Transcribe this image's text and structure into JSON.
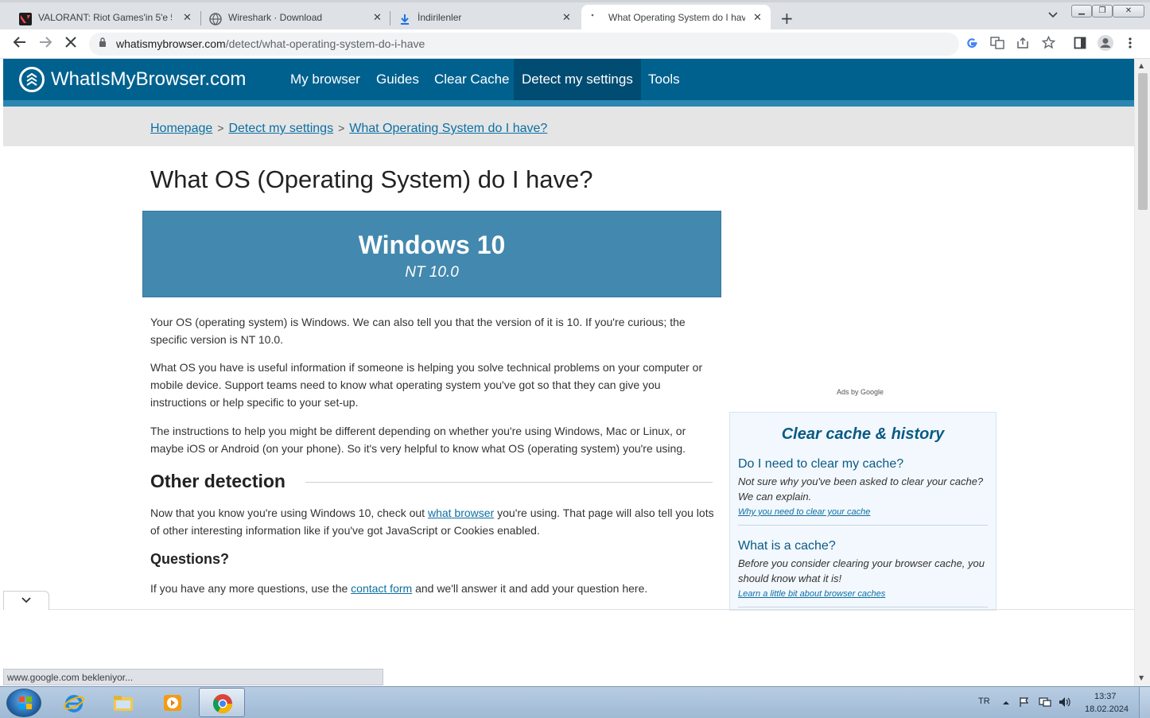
{
  "tabs": [
    {
      "title": "VALORANT: Riot Games'in 5'e 5",
      "icon": "valorant-icon",
      "color": "#d13639"
    },
    {
      "title": "Wireshark · Download",
      "icon": "globe-icon",
      "color": "#5f6368"
    },
    {
      "title": "İndirilenler",
      "icon": "download-icon",
      "color": "#1a73e8"
    },
    {
      "title": "What Operating System do I hav",
      "icon": "loading-icon",
      "color": "#5f6368"
    }
  ],
  "toolbar": {
    "url_host": "whatismybrowser.com",
    "url_path": "/detect/what-operating-system-do-i-have"
  },
  "site": {
    "logo": "WhatIsMyBrowser.com",
    "nav": [
      "My browser",
      "Guides",
      "Clear Cache",
      "Detect my settings",
      "Tools"
    ],
    "active_nav": "Detect my settings",
    "brand_color": "#00618f"
  },
  "breadcrumb": [
    "Homepage",
    "Detect my settings",
    "What Operating System do I have?"
  ],
  "content": {
    "title": "What OS (Operating System) do I have?",
    "os_name": "Windows 10",
    "os_version": "NT 10.0",
    "p1": "Your OS (operating system) is Windows. We can also tell you that the version of it is 10. If you're curious; the specific version is NT 10.0.",
    "p2": "What OS you have is useful information if someone is helping you solve technical problems on your computer or mobile device. Support teams need to know what operating system you've got so that they can give you instructions or help specific to your set-up.",
    "p3": "The instructions to help you might be different depending on whether you're using Windows, Mac or Linux, or maybe iOS or Android (on your phone). So it's very helpful to know what OS (operating system) you're using.",
    "other_heading": "Other detection",
    "p4_before": "Now that you know you're using Windows 10, check out ",
    "p4_link": "what browser",
    "p4_after": " you're using. That page will also tell you lots of other interesting information like if you've got JavaScript or Cookies enabled.",
    "questions_heading": "Questions?",
    "p5_before": "If you have any more questions, use the ",
    "p5_link": "contact form",
    "p5_after": " and we'll answer it and add your question here.",
    "ads_label": "Ads by Google"
  },
  "sidebar": {
    "title": "Clear cache & history",
    "items": [
      {
        "q": "Do I need to clear my cache?",
        "d": "Not sure why you've been asked to clear your cache? We can explain.",
        "link": "Why you need to clear your cache"
      },
      {
        "q": "What is a cache?",
        "d": "Before you consider clearing your browser cache, you should know what it is!",
        "link": "Learn a little bit about browser caches"
      }
    ]
  },
  "status": "www.google.com bekleniyor...",
  "taskbar": {
    "lang": "TR",
    "time": "13:37",
    "date": "18.02.2024"
  }
}
